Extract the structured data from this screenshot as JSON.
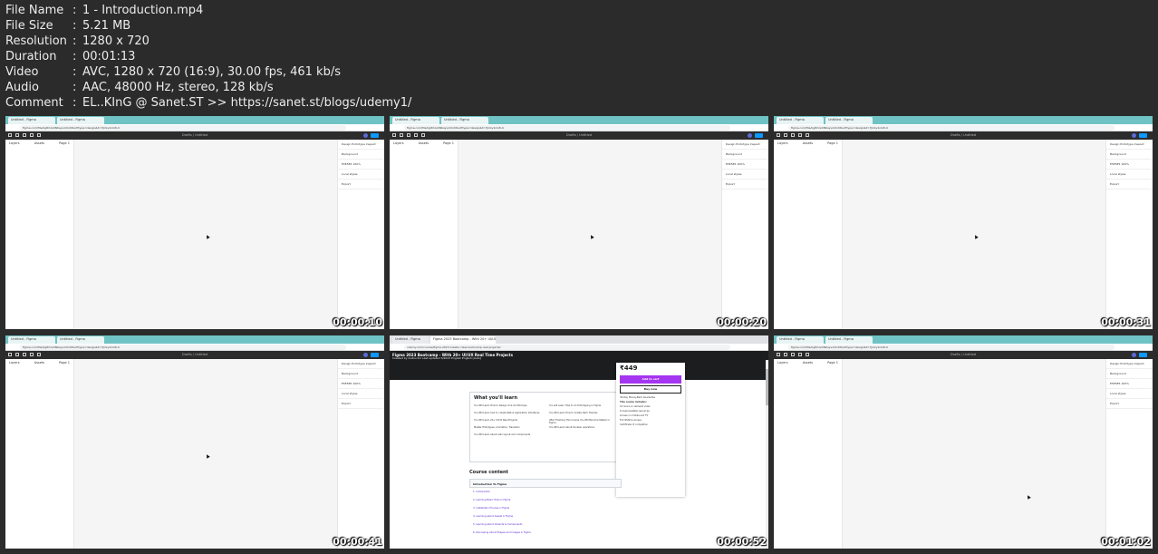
{
  "metadata": [
    {
      "key": "File Name",
      "value": "1 - Introduction.mp4"
    },
    {
      "key": "File Size",
      "value": "5.21 MB"
    },
    {
      "key": "Resolution",
      "value": "1280 x 720"
    },
    {
      "key": "Duration",
      "value": "00:01:13"
    },
    {
      "key": "Video",
      "value": "AVC, 1280 x 720 (16:9), 30.00 fps, 461 kb/s"
    },
    {
      "key": "Audio",
      "value": "AAC, 48000 Hz, stereo, 128 kb/s"
    },
    {
      "key": "Comment",
      "value": "EL..KInG @ Sanet.ST >> https://sanet.st/blogs/udemy1/"
    }
  ],
  "separator": ":",
  "figma": {
    "tab1": "Untitled - Figma",
    "tab2": "Untitled - Figma",
    "url": "figma.com/file/kg8rUsdiNKayvz/Untitled?type=design&t=7Jnlky1nkW-0",
    "title": "Drafts / Untitled",
    "left_rows": [
      "Layers",
      "Assets",
      "Page 1"
    ],
    "right_rows": [
      "Design   Prototype   Inspect",
      "Background",
      "E5E5E5   100%",
      "Local styles",
      "Export"
    ]
  },
  "udemy": {
    "tab": "Figma 2023 Bootcamp - With 20+ UI/UX Real Time Projects",
    "url": "udemy.com/course/figma-2023-master-class-bootcamp-real-projects/",
    "course_title": "Figma 2023 Bootcamp - With 20+ UI/UX Real Time Projects",
    "subline": "Created by Instructor  Last updated 5/2023  English  English [Auto]",
    "learn_heading": "What you'll learn",
    "learn_items": [
      "You Will Learn How to Design UI & UX Mockups",
      "You will Learn How to do Prototyping in Figma",
      "You Will Learn how to create Web & Application Interfaces",
      "You Will Learn How to Create Dark Themes",
      "You Will Learn 20+ UI/UX Real Projects",
      "After Finishing This Course You Will Become Master in Figma",
      "Master Prototypes, Animation, Transition",
      "You Will Learn about boolean operations",
      "You Will Learn about auto layout and components"
    ],
    "price": "₹449",
    "add_to_cart": "Add to cart",
    "buy_now": "Buy now",
    "card_notes": [
      "30-Day Money-Back Guarantee",
      "This course includes:",
      "10 hours on-demand video",
      "6 downloadable resources",
      "Access on mobile and TV",
      "Full lifetime access",
      "Certificate of completion"
    ],
    "content_heading": "Course content",
    "section_title": "Introduction To Figma",
    "lectures": [
      "1. Introduction",
      "2. Learning Basic Tools In Figma",
      "3. Installation Process in Figma",
      "4. Learning about Assets in Figma",
      "5. Learning about Variants & Components",
      "6. Discussing About Shapes and Images in Figma"
    ]
  },
  "thumbnails": [
    {
      "timestamp": "00:00:10",
      "kind": "figma"
    },
    {
      "timestamp": "00:00:20",
      "kind": "figma"
    },
    {
      "timestamp": "00:00:31",
      "kind": "figma"
    },
    {
      "timestamp": "00:00:41",
      "kind": "figma"
    },
    {
      "timestamp": "00:00:52",
      "kind": "udemy"
    },
    {
      "timestamp": "00:01:02",
      "kind": "figma"
    }
  ]
}
